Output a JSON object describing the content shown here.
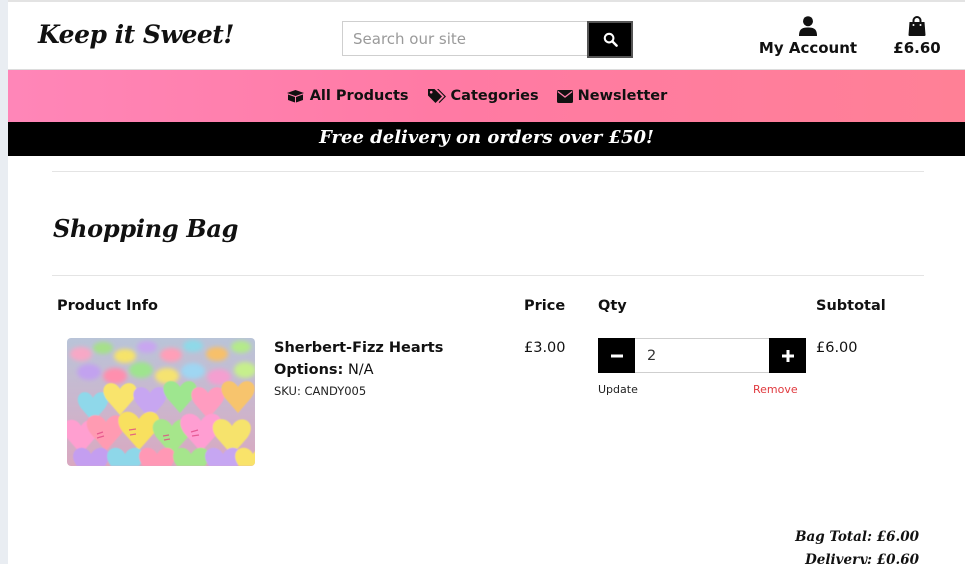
{
  "header": {
    "logo": "Keep it Sweet!",
    "search_placeholder": "Search our site",
    "account_label": "My Account",
    "bag_total": "£6.60"
  },
  "nav": {
    "items": [
      {
        "label": "All Products",
        "icon": "boxes-icon"
      },
      {
        "label": "Categories",
        "icon": "tags-icon"
      },
      {
        "label": "Newsletter",
        "icon": "envelope-icon"
      }
    ]
  },
  "banner": "Free delivery on orders over £50!",
  "bag": {
    "title": "Shopping Bag",
    "columns": [
      "Product Info",
      "Price",
      "Qty",
      "Subtotal"
    ],
    "items": [
      {
        "name": "Sherbert-Fizz Hearts",
        "options_label": "Options:",
        "options_value": "N/A",
        "sku": "SKU: CANDY005",
        "price": "£3.00",
        "qty": "2",
        "update_label": "Update",
        "remove_label": "Remove",
        "subtotal": "£6.00"
      }
    ],
    "bag_total": "Bag Total: £6.00",
    "delivery": "Delivery: £0.60"
  },
  "colors": {
    "nav_gradient_start": "#ff86b8",
    "nav_gradient_end": "#ff8096",
    "remove_link": "#e0393e",
    "banner_bg": "#000000"
  }
}
